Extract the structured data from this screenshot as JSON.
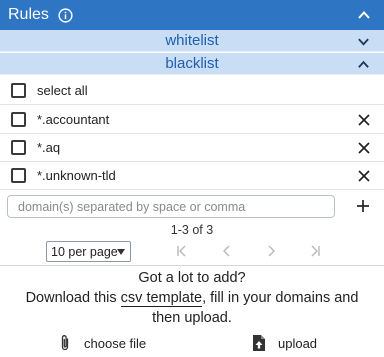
{
  "header": {
    "title": "Rules",
    "info_icon": "info-icon",
    "toggle_icon": "chevron-up-icon"
  },
  "sections": {
    "whitelist": {
      "label": "whitelist",
      "icon": "chevron-down-icon"
    },
    "blacklist": {
      "label": "blacklist",
      "icon": "chevron-up-icon"
    }
  },
  "list": {
    "select_all_label": "select all",
    "items": [
      {
        "label": "*.accountant"
      },
      {
        "label": "*.aq"
      },
      {
        "label": "*.unknown-tld"
      }
    ]
  },
  "add": {
    "placeholder": "domain(s) separated by space or comma",
    "icon": "plus-icon"
  },
  "pagination": {
    "range_text": "1-3 of 3",
    "per_page": "10 per page",
    "icons": [
      "first-page-icon",
      "prev-page-icon",
      "next-page-icon",
      "last-page-icon"
    ]
  },
  "help": {
    "line1": "Got a lot to add?",
    "line2_prefix": "Download this ",
    "link_text": "csv template",
    "line2_suffix": ", fill in your domains and",
    "line3": "then upload."
  },
  "actions": {
    "choose_file_label": "choose file",
    "upload_label": "upload"
  },
  "colors": {
    "header": "#2e75c4",
    "section": "#c9def5",
    "section_text": "#1d5fae"
  }
}
